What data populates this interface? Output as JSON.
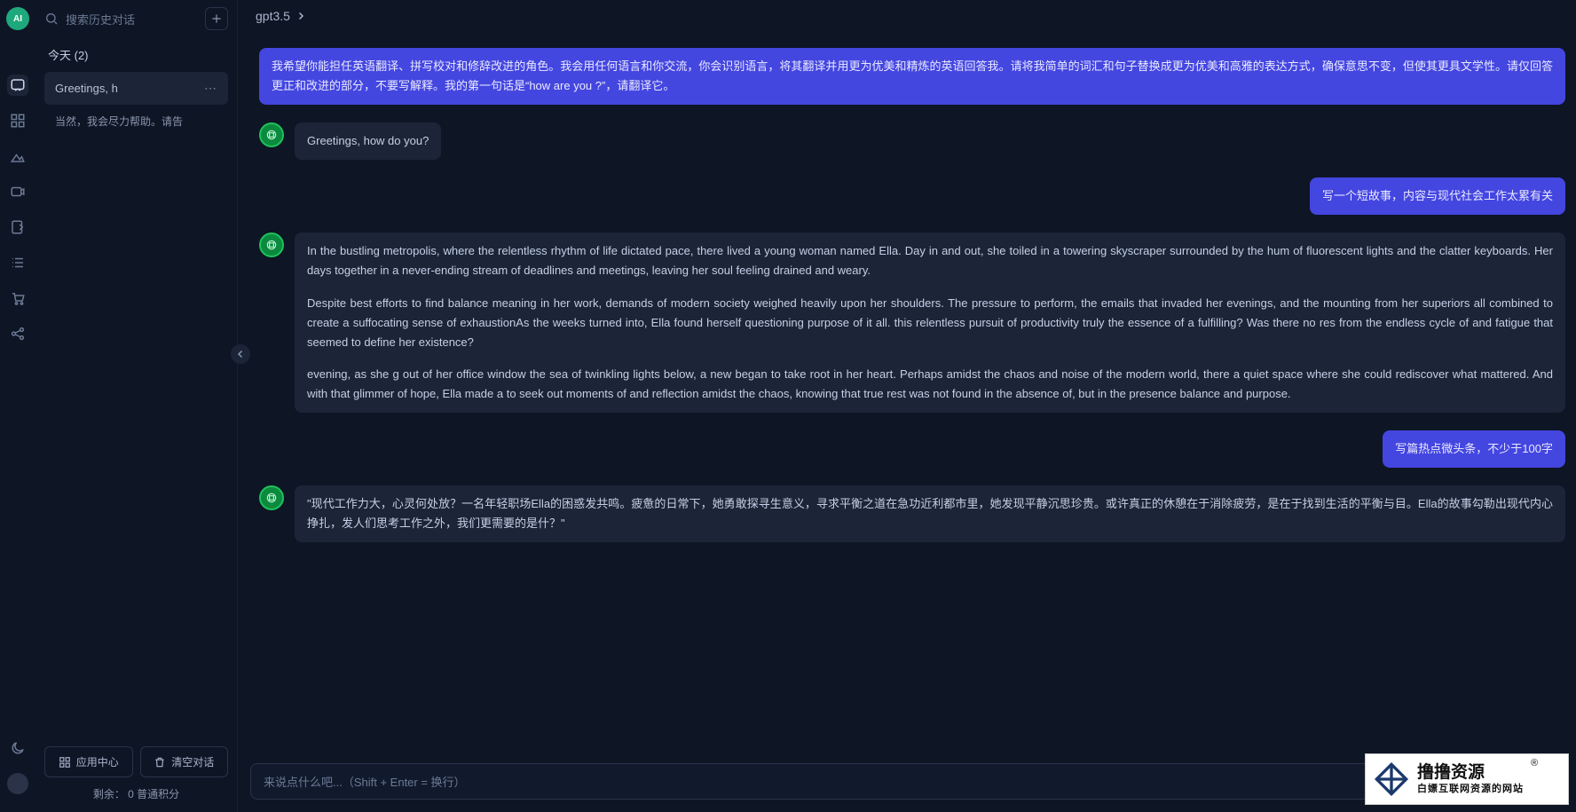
{
  "rail": {
    "avatar_label": "AI"
  },
  "sidebar": {
    "search_placeholder": "搜索历史对话",
    "date_header": "今天  (2)",
    "conversations": [
      {
        "title": "Greetings, h",
        "preview": "当然，我会尽力帮助。请告"
      }
    ],
    "footer": {
      "app_center": "应用中心",
      "clear_chat": "清空对话",
      "credit": "剩余： 0 普通积分"
    }
  },
  "header": {
    "model": "gpt3.5"
  },
  "messages": [
    {
      "role": "user",
      "wide": true,
      "text": "我希望你能担任英语翻译、拼写校对和修辞改进的角色。我会用任何语言和你交流，你会识别语言，将其翻译并用更为优美和精炼的英语回答我。请将我简单的词汇和句子替换成更为优美和高雅的表达方式，确保意思不变，但使其更具文学性。请仅回答更正和改进的部分，不要写解释。我的第一句话是“how are you ?”，请翻译它。"
    },
    {
      "role": "assistant",
      "text": "Greetings, how do you?"
    },
    {
      "role": "user",
      "text": "写一个短故事，内容与现代社会工作太累有关"
    },
    {
      "role": "assistant",
      "wide": true,
      "paragraphs": [
        "In the bustling metropolis, where the relentless rhythm of life dictated pace, there lived a young woman named Ella. Day in and out, she toiled in a towering skyscraper surrounded by the hum of fluorescent lights and the clatter keyboards. Her days together in a never-ending stream of deadlines and meetings, leaving her soul feeling drained and weary.",
        "Despite best efforts to find balance meaning in her work, demands of modern society weighed heavily upon her shoulders. The pressure to perform, the emails that invaded her evenings, and the mounting from her superiors all combined to create a suffocating sense of exhaustionAs the weeks turned into, Ella found herself questioning purpose of it all. this relentless pursuit of productivity truly the essence of a fulfilling? Was there no res from the endless cycle of and fatigue that seemed to define her existence?",
        "evening, as she g out of her office window the sea of twinkling lights below, a new began to take root in her heart. Perhaps amidst the chaos and noise of the modern world, there a quiet space where she could rediscover what mattered. And with that glimmer of hope, Ella made a to seek out moments of and reflection amidst the chaos, knowing that true rest was not found in the absence of, but in the presence balance and purpose."
      ]
    },
    {
      "role": "user",
      "text": "写篇热点微头条，不少于100字"
    },
    {
      "role": "assistant",
      "wide": true,
      "text": "\"现代工作力大，心灵何处放？一名年轻职场Ella的困惑发共鸣。疲惫的日常下，她勇敢探寻生意义，寻求平衡之道在急功近利都市里，她发现平静沉思珍贵。或许真正的休憩在于消除疲劳，是在于找到生活的平衡与目。Ella的故事勾勒出现代内心挣扎，发人们思考工作之外，我们更需要的是什？\""
    }
  ],
  "input": {
    "placeholder": "来说点什么吧...（Shift + Enter = 换行）"
  },
  "watermark": {
    "big": "撸撸资源",
    "small": "白嫖互联网资源的网站"
  }
}
